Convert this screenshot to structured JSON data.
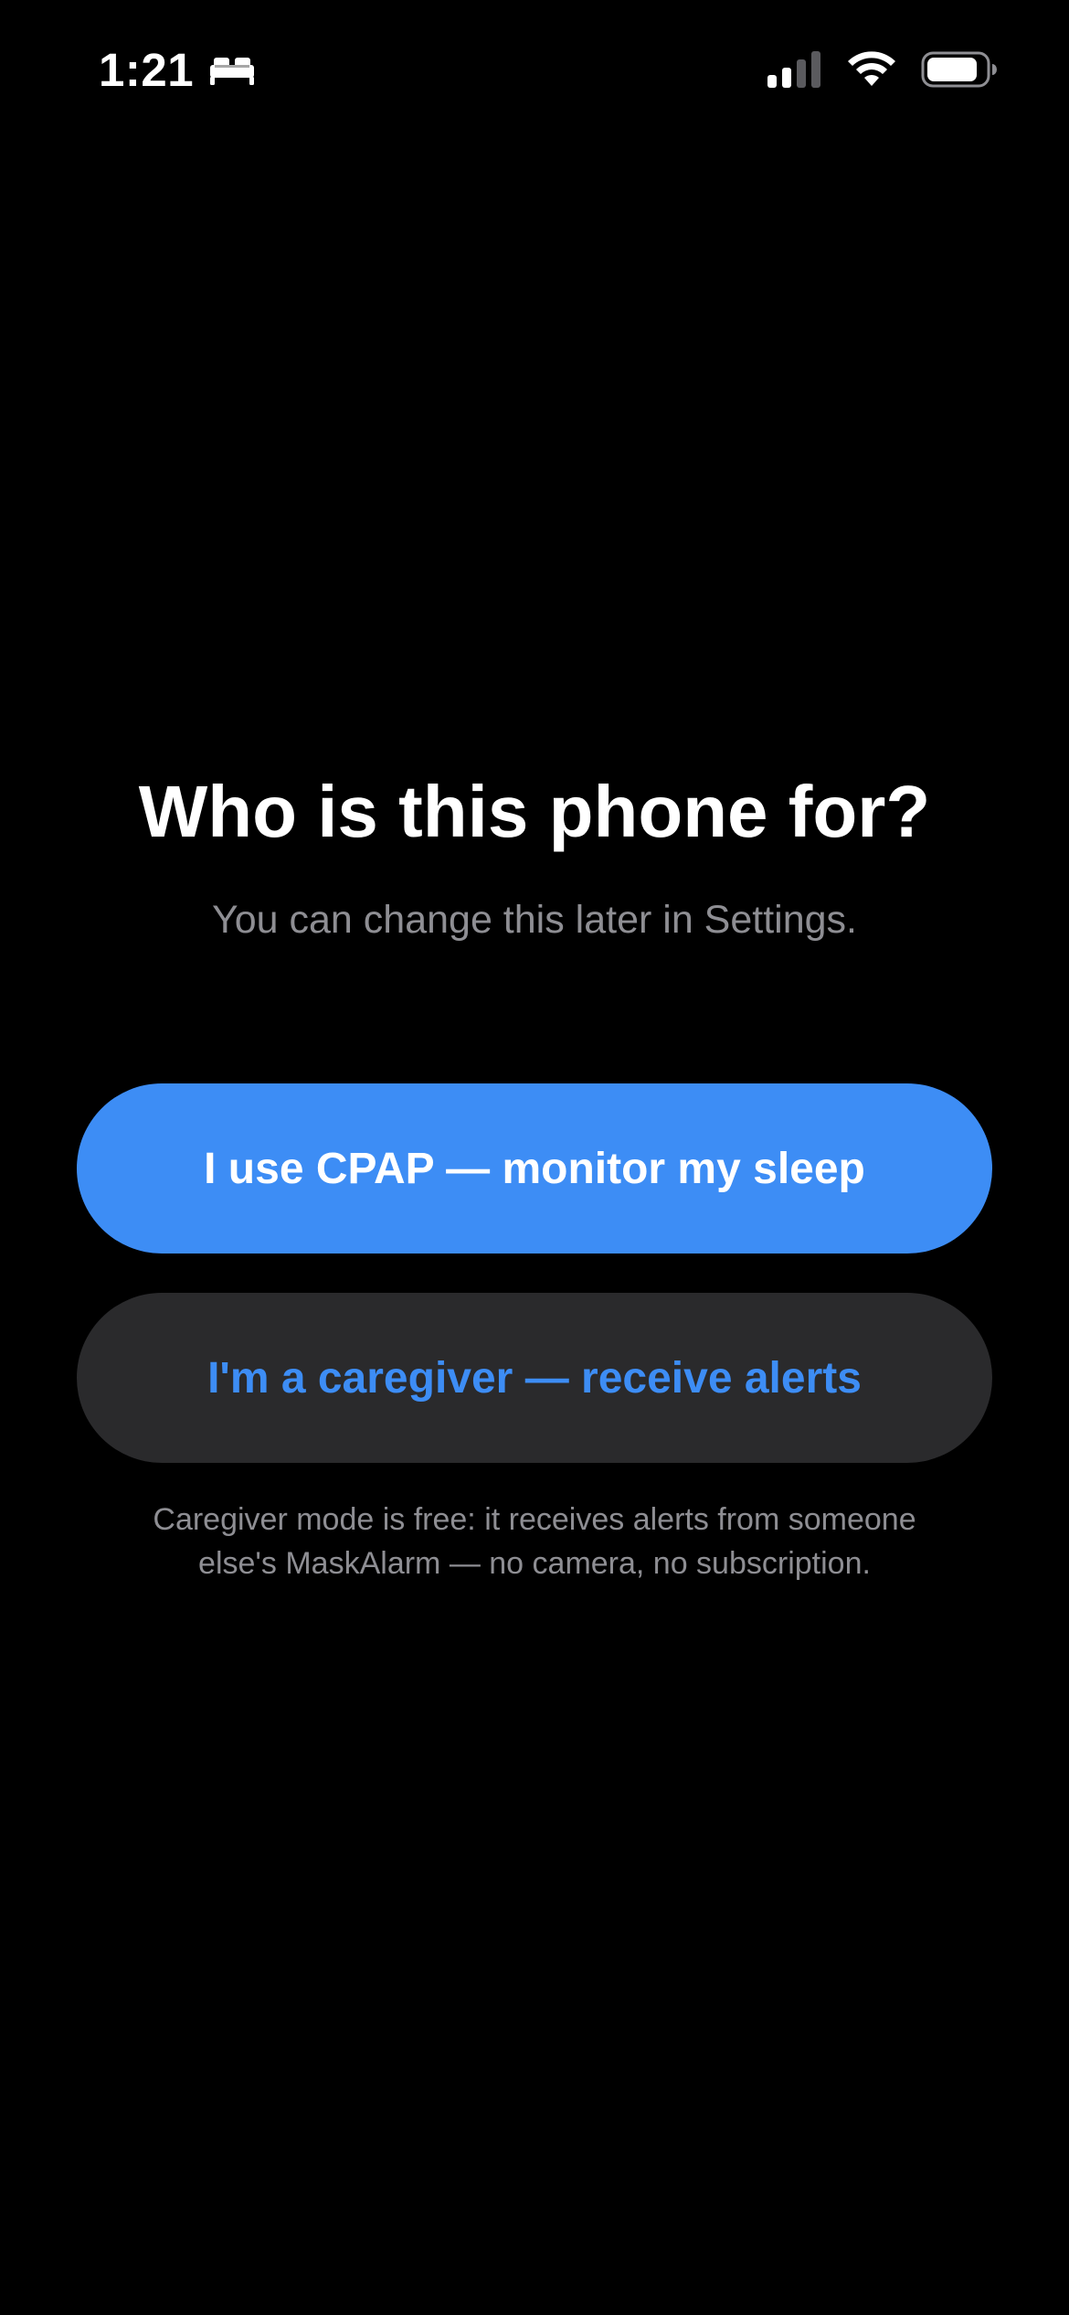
{
  "status_bar": {
    "time": "1:21",
    "focus_icon": "bed-icon",
    "signal_icon": "cellular-signal-icon",
    "wifi_icon": "wifi-icon",
    "battery_icon": "battery-icon"
  },
  "onboarding": {
    "title": "Who is this phone for?",
    "subtitle": "You can change this later in Settings.",
    "primary_button_label": "I use CPAP — monitor my sleep",
    "secondary_button_label": "I'm a caregiver — receive alerts",
    "footnote_line1": "Caregiver mode is free: it receives alerts from someone",
    "footnote_line2": "else's MaskAlarm — no camera, no subscription."
  },
  "colors": {
    "background": "#000000",
    "accent": "#3d8df5",
    "secondary_button_bg": "#2a2a2c",
    "muted_text": "#8e8e93"
  }
}
